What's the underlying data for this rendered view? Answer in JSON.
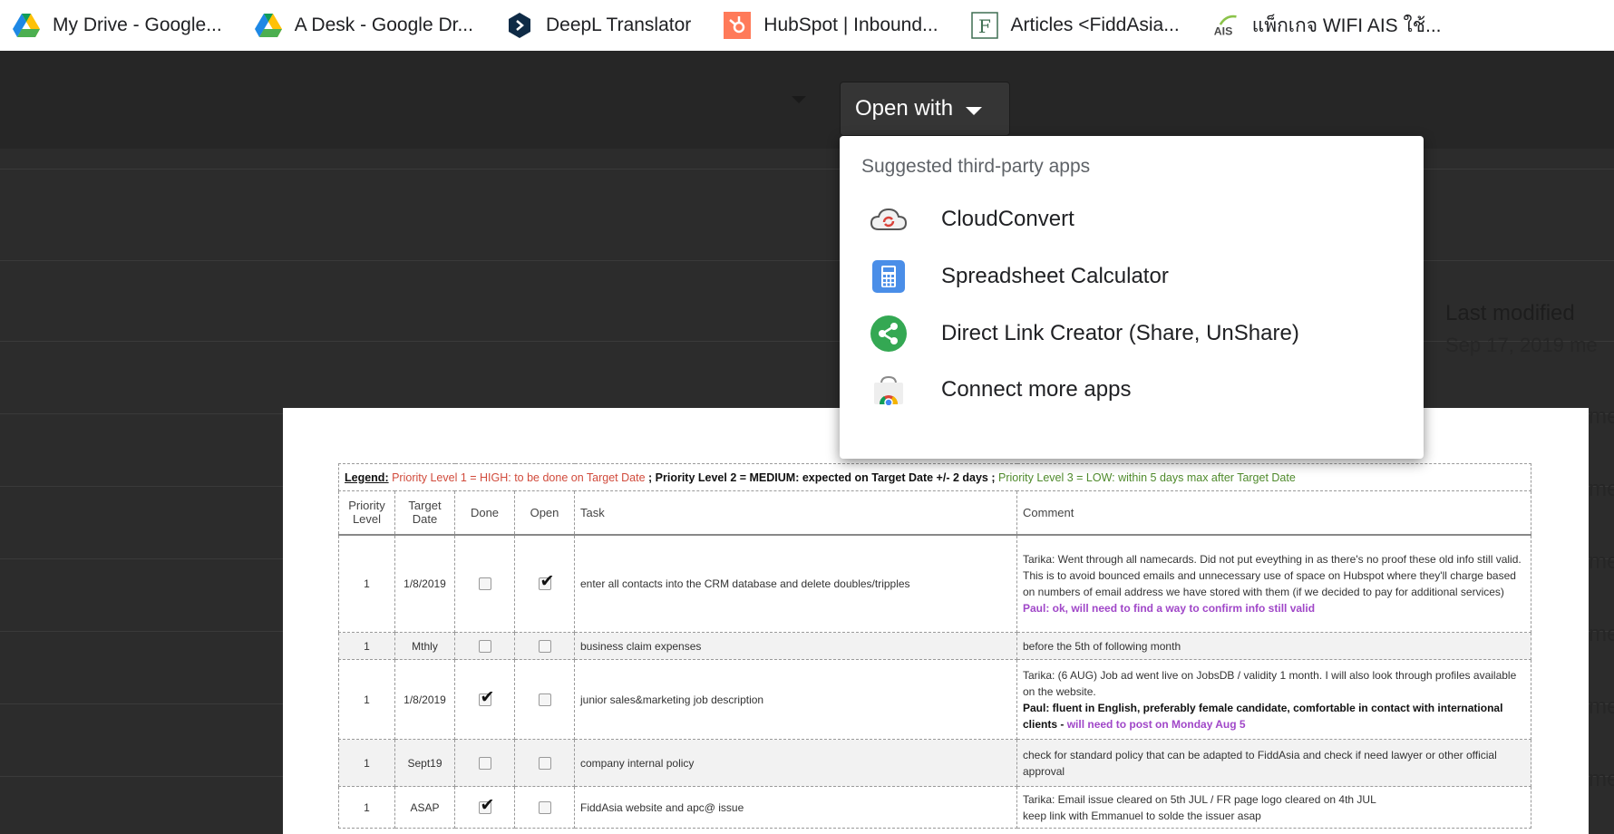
{
  "bookmarks": [
    {
      "label": "My Drive - Google...",
      "icon": "google-drive-icon"
    },
    {
      "label": "A Desk - Google Dr...",
      "icon": "google-drive-icon"
    },
    {
      "label": "DeepL Translator",
      "icon": "deepl-icon"
    },
    {
      "label": "HubSpot | Inbound...",
      "icon": "hubspot-icon"
    },
    {
      "label": "Articles <FiddAsia...",
      "icon": "fiddasia-icon"
    },
    {
      "label": "แพ็กเกจ WIFI AIS ใช้...",
      "icon": "ais-icon"
    }
  ],
  "drive": {
    "last_modified_label": "Last modified",
    "last_modified_date": "Sep 17, 2019 me",
    "right_clip": "me"
  },
  "open_with": {
    "label": "Open with"
  },
  "menu": {
    "title": "Suggested third-party apps",
    "items": [
      {
        "label": "CloudConvert",
        "icon": "cloudconvert-icon"
      },
      {
        "label": "Spreadsheet Calculator",
        "icon": "calculator-icon"
      },
      {
        "label": "Direct Link Creator (Share, UnShare)",
        "icon": "share-icon"
      },
      {
        "label": "Connect more apps",
        "icon": "chrome-web-store-icon"
      }
    ]
  },
  "document": {
    "legend": {
      "prefix": "Legend:",
      "p1": "Priority Level 1 = HIGH: to be done on Target Date",
      "sep": " ; ",
      "p2": "Priority Level 2 = MEDIUM: expected on Target Date +/- 2 days",
      "p3": "Priority Level 3 = LOW: within 5 days max after Target Date"
    },
    "headers": [
      "Priority Level",
      "Target Date",
      "Done",
      "Open",
      "Task",
      "Comment"
    ],
    "rows": [
      {
        "priority": "1",
        "date": "1/8/2019",
        "done": false,
        "open": true,
        "task": "enter all contacts into the CRM database and delete doubles/tripples",
        "comment": "Tarika: Went through all namecards. Did not put eveything in as there's no proof these old info still valid. This is to avoid bounced emails and unnecessary use of space on Hubspot where they'll charge based on numbers of email address we have stored with them (if we decided to pay for additional services)",
        "comment_purple": "Paul: ok, will need to find a way to confirm info still valid"
      },
      {
        "priority": "1",
        "date": "Mthly",
        "done": false,
        "open": false,
        "task": "business claim expenses",
        "comment": "before the 5th of following month"
      },
      {
        "priority": "1",
        "date": "1/8/2019",
        "done": true,
        "open": false,
        "task": "junior sales&marketing job description",
        "comment": "Tarika: (6 AUG) Job ad went live on JobsDB / validity 1 month. I will also look through profiles available on the website.",
        "comment_bold": "Paul: fluent in English, preferably female candidate, comfortable in contact with international clients -",
        "comment_purple": "will need to post on Monday Aug 5"
      },
      {
        "priority": "1",
        "date": "Sept19",
        "done": false,
        "open": false,
        "task": "company internal policy",
        "comment": "check for standard policy that can be adapted to FiddAsia and check if need lawyer or other official approval"
      },
      {
        "priority": "1",
        "date": "ASAP",
        "done": true,
        "open": false,
        "task": "FiddAsia website and apc@ issue",
        "comment": "Tarika: Email issue cleared on 5th JUL / FR page logo cleared on 4th JUL",
        "comment_line2": "keep link with Emmanuel to solde the issuer asap"
      }
    ]
  }
}
